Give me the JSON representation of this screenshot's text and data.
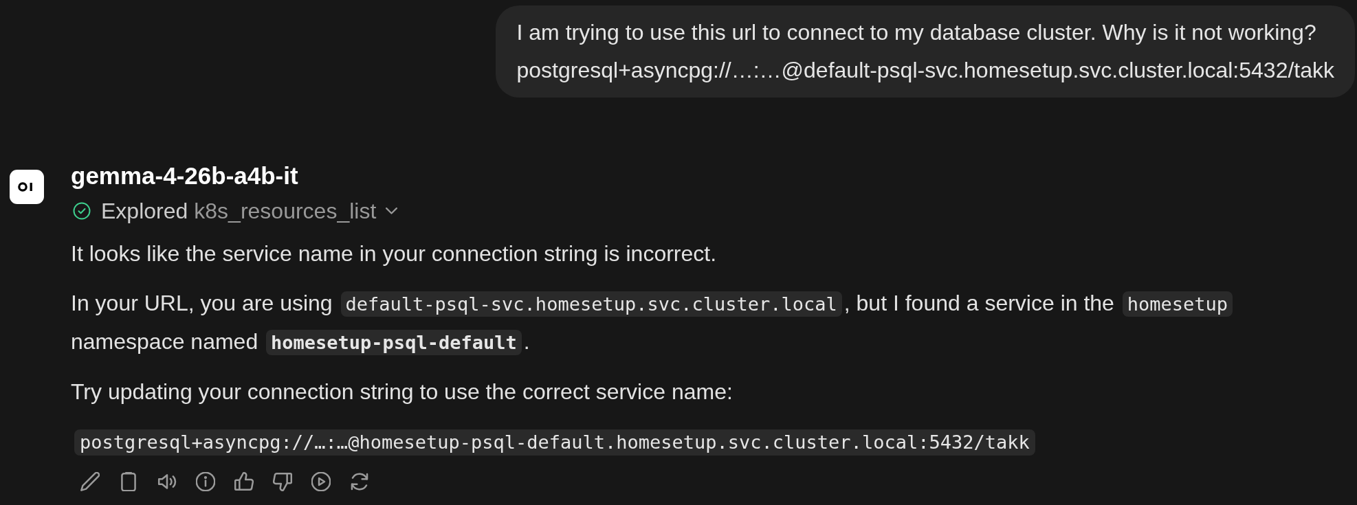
{
  "user_message": {
    "lines": [
      "I am trying to use this url to connect to my database cluster. Why is it not working?",
      "postgresql+asyncpg://…:…@default-psql-svc.homesetup.svc.cluster.local:5432/takk"
    ]
  },
  "assistant": {
    "model_name": "gemma-4-26b-a4b-it",
    "tool_call": {
      "verb": "Explored",
      "target": "k8s_resources_list",
      "completed": true,
      "expanded": false
    },
    "paragraphs": [
      {
        "segments": [
          {
            "kind": "text",
            "text": "It looks like the service name in your connection string is incorrect."
          }
        ]
      },
      {
        "segments": [
          {
            "kind": "text",
            "text": "In your URL, you are using "
          },
          {
            "kind": "code",
            "text": "default-psql-svc.homesetup.svc.cluster.local",
            "bold": false
          },
          {
            "kind": "text",
            "text": ", but I found a service in the "
          },
          {
            "kind": "code",
            "text": "homesetup",
            "bold": false
          },
          {
            "kind": "text",
            "text": " namespace named "
          },
          {
            "kind": "code",
            "text": "homesetup-psql-default",
            "bold": true
          },
          {
            "kind": "text",
            "text": "."
          }
        ]
      },
      {
        "segments": [
          {
            "kind": "text",
            "text": "Try updating your connection string to use the correct service name:"
          }
        ]
      }
    ],
    "code_block": {
      "text": "postgresql+asyncpg://…:…@homesetup-psql-default.homesetup.svc.cluster.local:5432/takk"
    }
  }
}
